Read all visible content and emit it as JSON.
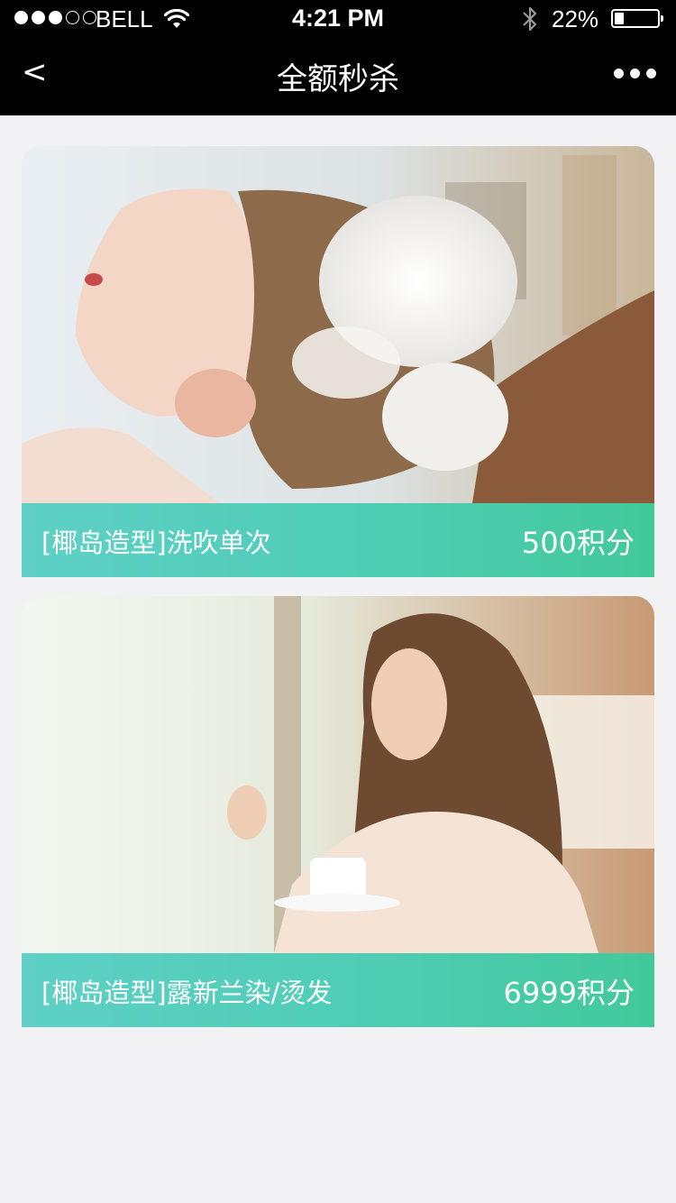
{
  "status_bar": {
    "carrier": "BELL",
    "time": "4:21 PM",
    "battery_percent": "22%",
    "battery_level": 0.22,
    "signal_bars": 3,
    "signal_total": 5
  },
  "nav": {
    "back_label": "<",
    "title": "全额秒杀",
    "more_icon": "more-dots-icon"
  },
  "items": [
    {
      "name": "[椰岛造型]洗吹单次",
      "price": "500积分",
      "image": "hair-wash-photo"
    },
    {
      "name": "[椰岛造型]露新兰染/烫发",
      "price": "6999积分",
      "image": "woman-with-coffee-photo"
    }
  ],
  "colors": {
    "caption_start": "#5ed0c6",
    "caption_end": "#42c99a",
    "background": "#f2f2f4",
    "topbar": "#000000"
  }
}
